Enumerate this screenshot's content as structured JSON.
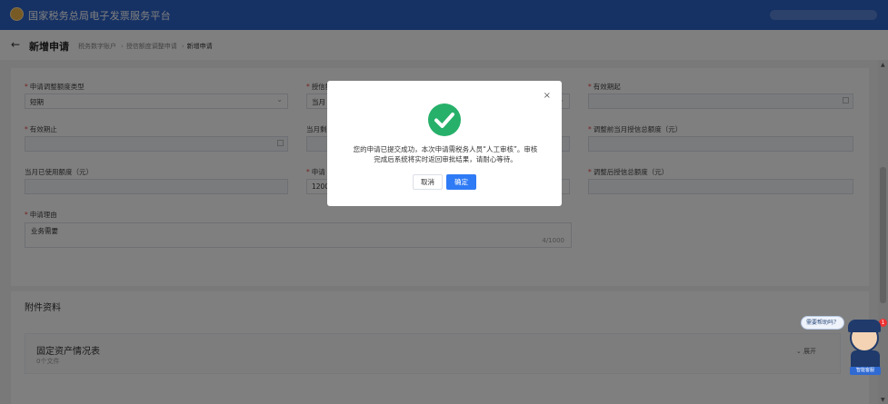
{
  "app": {
    "title": "国家税务总局电子发票服务平台"
  },
  "page": {
    "title": "新增申请",
    "breadcrumb": [
      "税务数字账户",
      "授信额度调整申请",
      "新增申请"
    ]
  },
  "form": {
    "fields": [
      {
        "label": "申请调整额度类型",
        "required": true,
        "value": "短期",
        "kind": "select"
      },
      {
        "label": "授信额度",
        "required": true,
        "value": "当月",
        "kind": "select"
      },
      {
        "label": "有效期起",
        "required": true,
        "value": "",
        "kind": "date"
      },
      {
        "label": "有效期止",
        "required": true,
        "value": "",
        "kind": "date"
      },
      {
        "label": "当月剩余",
        "required": false,
        "value": "",
        "kind": "text"
      },
      {
        "label": "调整前当月授信总额度（元）",
        "required": true,
        "value": "",
        "kind": "text"
      },
      {
        "label": "当月已使用额度（元）",
        "required": false,
        "value": "",
        "kind": "text"
      },
      {
        "label": "申请",
        "required": true,
        "value": "1200",
        "kind": "text"
      },
      {
        "label": "调整后授信总额度（元）",
        "required": true,
        "value": "",
        "kind": "text"
      }
    ],
    "reason": {
      "label": "申请理由",
      "value": "业务需要",
      "counter": "4/1000"
    }
  },
  "attachments": {
    "section_title": "附件资料",
    "items": [
      {
        "name": "固定资产情况表",
        "count": "0个文件",
        "expand_label": "展开"
      }
    ]
  },
  "dialog": {
    "close_glyph": "×",
    "message": "您的申请已提交成功，本次申请需税务人员“人工审核”。审核完成后系统将实时返回审批结果，请耐心等待。",
    "cancel_label": "取消",
    "confirm_label": "确定",
    "success_color": "#27b06a"
  },
  "assistant": {
    "bubble": "需要帮助吗？",
    "badge": "1",
    "tag": "智能客服"
  },
  "colors": {
    "header": "#2c63c8",
    "primary": "#2f7bf5"
  }
}
